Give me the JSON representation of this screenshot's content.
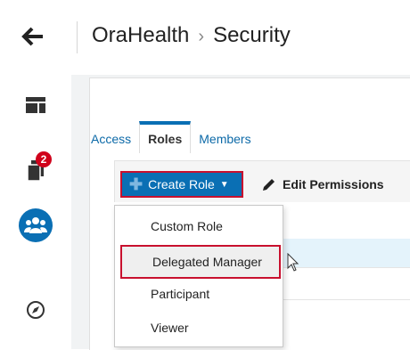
{
  "header": {
    "back_icon": "back-arrow-icon",
    "breadcrumb": [
      "OraHealth",
      "Security"
    ],
    "separator": "›"
  },
  "sidebar": {
    "items": [
      {
        "icon": "layout-icon",
        "active": false
      },
      {
        "icon": "documents-icon",
        "badge": "2",
        "active": false
      },
      {
        "icon": "group-icon",
        "active": true
      },
      {
        "icon": "compass-icon",
        "active": false
      }
    ]
  },
  "tabs": [
    {
      "label": "Access",
      "selected": false
    },
    {
      "label": "Roles",
      "selected": true
    },
    {
      "label": "Members",
      "selected": false
    }
  ],
  "toolbar": {
    "create_role_label": "Create Role",
    "edit_permissions_label": "Edit Permissions"
  },
  "dropdown": {
    "items": [
      "Custom Role",
      "Delegated Manager",
      "Participant",
      "Viewer"
    ],
    "highlighted": "Delegated Manager"
  },
  "colors": {
    "accent": "#0a6fb4",
    "highlight_border": "#c8102e",
    "badge": "#d0021b",
    "row_highlight": "#e4f3fb"
  }
}
